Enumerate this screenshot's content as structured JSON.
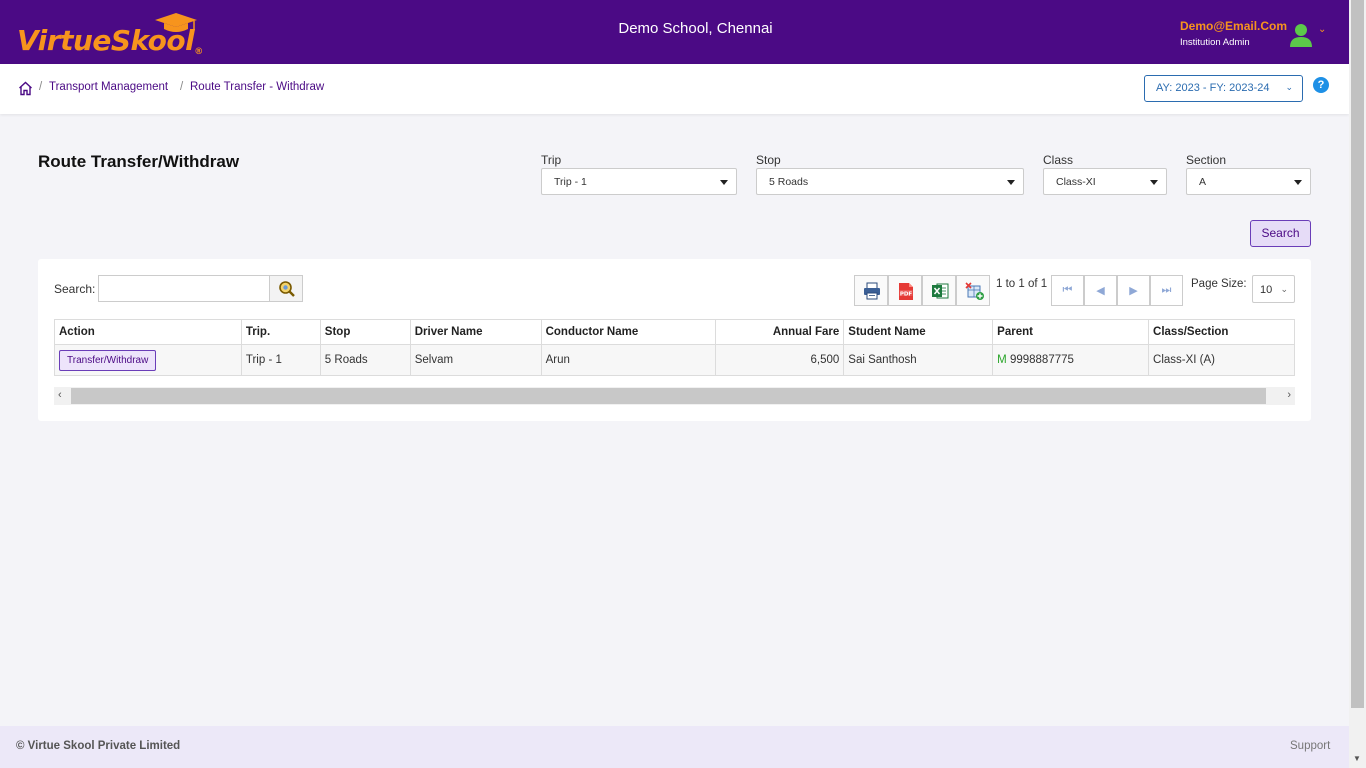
{
  "header": {
    "logo_text": "VirtueSkool",
    "logo_mark": "®",
    "school_name": "Demo School, Chennai",
    "user_email": "Demo@Email.Com",
    "user_role": "Institution Admin",
    "brand_color": "#4b0a85",
    "accent_color": "#f7941d"
  },
  "breadcrumb": {
    "items": [
      "Transport Management",
      "Route Transfer - Withdraw"
    ],
    "separator": "/",
    "academic_year": "AY: 2023 - FY: 2023-24",
    "help": "?"
  },
  "page": {
    "title": "Route Transfer/Withdraw"
  },
  "filters": {
    "trip_label": "Trip",
    "trip_value": "Trip - 1",
    "stop_label": "Stop",
    "stop_value": "5 Roads",
    "class_label": "Class",
    "class_value": "Class-XI",
    "section_label": "Section",
    "section_value": "A",
    "search_button": "Search"
  },
  "grid": {
    "search_label": "Search:",
    "search_value": "",
    "tools": [
      "print-icon",
      "pdf-icon",
      "excel-icon",
      "export-columns-icon"
    ],
    "pager_text": "1 to 1 of 1",
    "page_size_label": "Page Size:",
    "page_size": "10",
    "columns": [
      "Action",
      "Trip.",
      "Stop",
      "Driver Name",
      "Conductor Name",
      "Annual Fare",
      "Student Name",
      "Parent",
      "Class/Section"
    ],
    "rows": [
      {
        "action": "Transfer/Withdraw",
        "trip": "Trip - 1",
        "stop": "5 Roads",
        "driver": "Selvam",
        "conductor": "Arun",
        "fare": "6,500",
        "student": "Sai Santhosh",
        "parent_tag": "M",
        "parent_phone": "9998887775",
        "class_section": "Class-XI (A)"
      }
    ]
  },
  "footer": {
    "copyright": "© Virtue Skool Private Limited",
    "support": "Support"
  }
}
